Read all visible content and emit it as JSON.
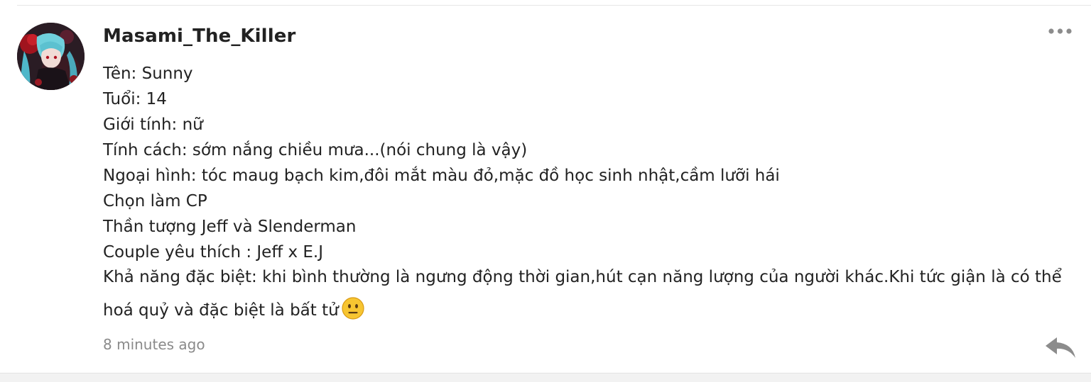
{
  "comment": {
    "username": "Masami_The_Killer",
    "avatar_icon": "anime-girl-avatar",
    "lines": [
      "Tên: Sunny",
      "Tuổi: 14",
      "Giới tính: nữ",
      "Tính cách: sớm nắng chiều mưa...(nói chung là vậy)",
      "Ngoại hình: tóc maug bạch kim,đôi mắt màu đỏ,mặc đồ học sinh nhật,cầm lưỡi hái",
      "Chọn làm CP",
      "Thần tượng Jeff và Slenderman",
      "Couple yêu thích : Jeff x E.J",
      "Khả năng đặc biệt: khi bình thường là ngưng động thời gian,hút cạn năng lượng của người khác.Khi tức giận là có thể hoá quỷ và đặc biệt là bất tử"
    ],
    "emoji": "neutral-face-emoji",
    "timestamp": "8 minutes ago",
    "more_icon": "more-options-icon",
    "reply_icon": "reply-arrow-icon"
  },
  "colors": {
    "text": "#222222",
    "muted": "#8a8a8a",
    "icon": "#8c8c8c",
    "divider": "#e6e6e6"
  }
}
